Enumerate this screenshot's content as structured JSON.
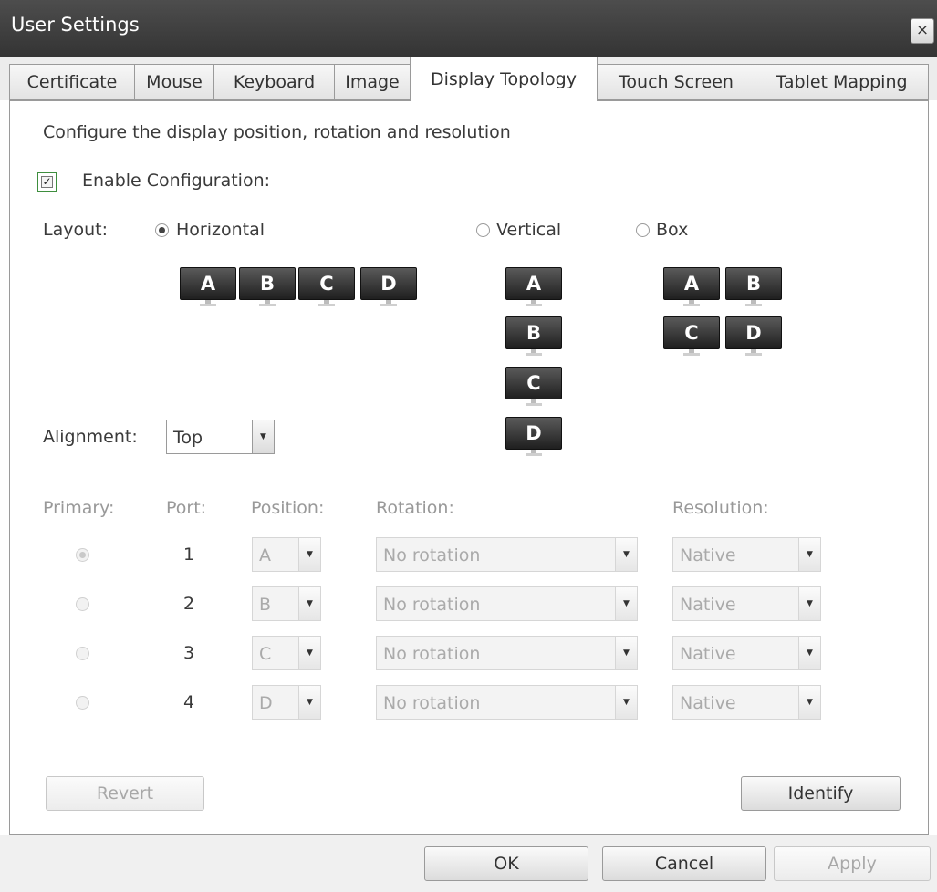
{
  "window": {
    "title": "User Settings",
    "close_glyph": "×"
  },
  "tabs": [
    {
      "label": "Certificate"
    },
    {
      "label": "Mouse"
    },
    {
      "label": "Keyboard"
    },
    {
      "label": "Image"
    },
    {
      "label": "Display Topology",
      "active": true
    },
    {
      "label": "Touch Screen"
    },
    {
      "label": "Tablet Mapping"
    }
  ],
  "panel": {
    "description": "Configure the display position, rotation and resolution",
    "enable_configuration": {
      "label": "Enable Configuration:",
      "checked": true,
      "mark": "✓"
    },
    "layout": {
      "label": "Layout:",
      "options": [
        {
          "label": "Horizontal",
          "selected": true
        },
        {
          "label": "Vertical",
          "selected": false
        },
        {
          "label": "Box",
          "selected": false
        }
      ],
      "monitor_letters": [
        "A",
        "B",
        "C",
        "D"
      ]
    },
    "alignment": {
      "label": "Alignment:",
      "value": "Top"
    },
    "table": {
      "headers": {
        "primary": "Primary:",
        "port": "Port:",
        "position": "Position:",
        "rotation": "Rotation:",
        "resolution": "Resolution:"
      },
      "rows": [
        {
          "primary": true,
          "port": "1",
          "position": "A",
          "rotation": "No rotation",
          "resolution": "Native"
        },
        {
          "primary": false,
          "port": "2",
          "position": "B",
          "rotation": "No rotation",
          "resolution": "Native"
        },
        {
          "primary": false,
          "port": "3",
          "position": "C",
          "rotation": "No rotation",
          "resolution": "Native"
        },
        {
          "primary": false,
          "port": "4",
          "position": "D",
          "rotation": "No rotation",
          "resolution": "Native"
        }
      ]
    },
    "revert_label": "Revert",
    "identify_label": "Identify"
  },
  "footer": {
    "ok_label": "OK",
    "cancel_label": "Cancel",
    "apply_label": "Apply"
  },
  "icons": {
    "dropdown_arrow": "▼"
  },
  "colors": {
    "titlebar": "#3c3c3c",
    "checkbox_focus": "#3e8e3e",
    "monitor": "#2b2b2b"
  }
}
